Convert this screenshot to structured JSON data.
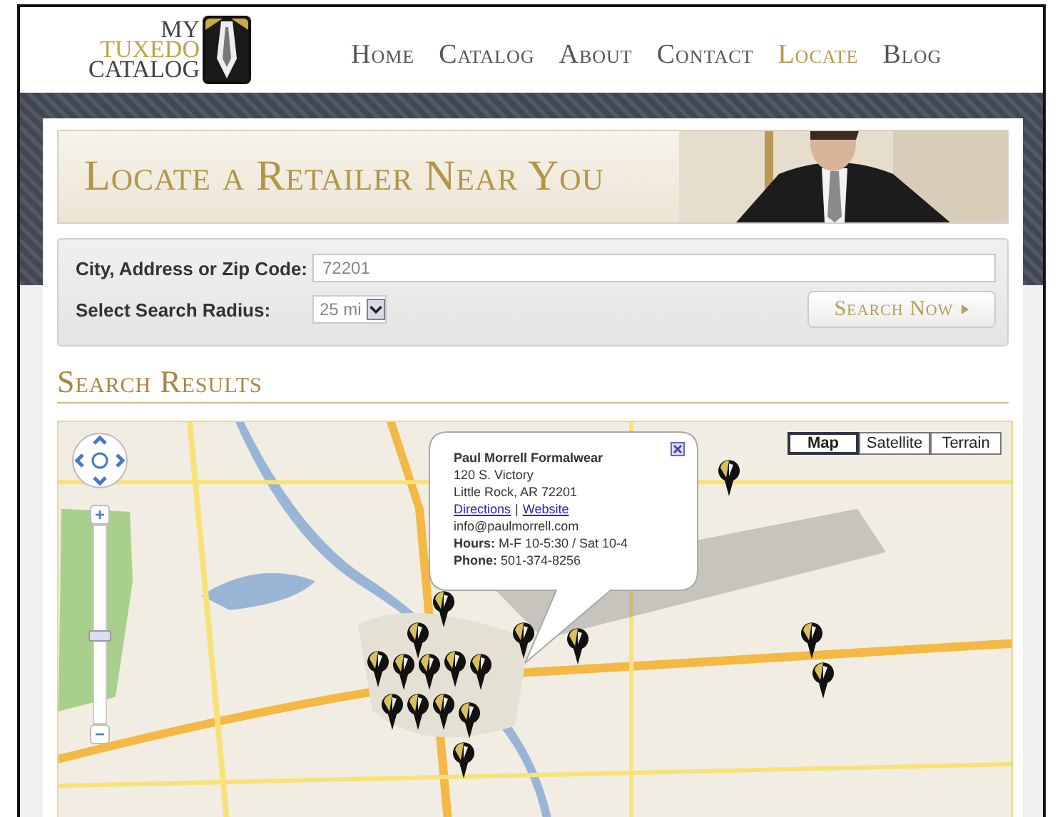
{
  "logo": {
    "line_1": "MY",
    "line_2": "TUXEDO",
    "line_3": "CATALOG"
  },
  "nav": [
    {
      "label": "Home",
      "selected": false
    },
    {
      "label": "Catalog",
      "selected": false
    },
    {
      "label": "About",
      "selected": false
    },
    {
      "label": "Contact",
      "selected": false
    },
    {
      "label": "Locate",
      "selected": true
    },
    {
      "label": "Blog",
      "selected": false
    }
  ],
  "banner": {
    "title": "Locate a Retailer Near You"
  },
  "search": {
    "location_label": "City, Address or Zip Code:",
    "location_value": "72201",
    "radius_label": "Select Search Radius:",
    "radius_value": "25 mi",
    "button": "Search Now"
  },
  "results": {
    "heading": "Search Results"
  },
  "map": {
    "map_types": [
      {
        "label": "Map",
        "selected": true
      },
      {
        "label": "Satellite",
        "selected": false
      },
      {
        "label": "Terrain",
        "selected": false
      }
    ],
    "zoom_in": "+",
    "zoom_out": "−",
    "zoom_slider": {
      "level": 0.45
    },
    "info_window": {
      "name": "Paul Morrell Formalwear",
      "address_1": "120 S. Victory",
      "address_2": "Little Rock, AR 72201",
      "links": [
        "Directions",
        "Website"
      ],
      "separator": "|",
      "email": "info@paulmorrell.com",
      "hours": "**Hours:** M-F 10-5:30 / Sat 10-4",
      "phone": "**Phone:** 501-374-8256"
    }
  }
}
